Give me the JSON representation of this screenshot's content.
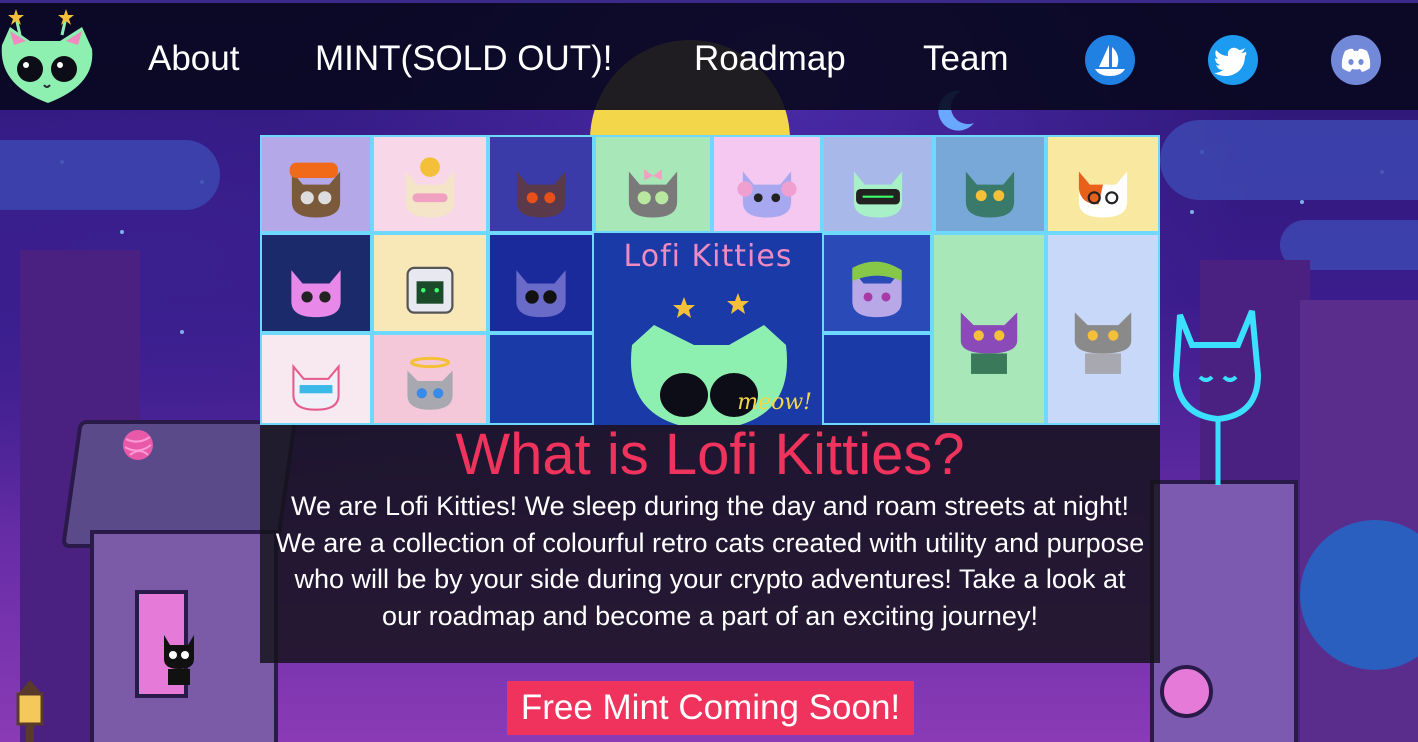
{
  "nav": {
    "about": "About",
    "mint": "MINT(SOLD OUT)!",
    "roadmap": "Roadmap",
    "team": "Team"
  },
  "social": {
    "opensea": "opensea-icon",
    "twitter": "twitter-icon",
    "discord": "discord-icon"
  },
  "banner": {
    "title": "Lofi Kitties",
    "meow": "meow!"
  },
  "about": {
    "title": "What is Lofi Kitties?",
    "text": "We are Lofi Kitties! We sleep during the day and roam streets at night! We are a collection of colourful retro cats created with utility and purpose who will be by your side during your crypto adventures! Take a look at our roadmap and become a part of an exciting journey!"
  },
  "cta": {
    "label": "Free Mint Coming Soon!"
  },
  "colors": {
    "accent": "#f0335c",
    "header_bg": "#08081e",
    "opensea": "#2081e2",
    "twitter": "#1d9bf0",
    "discord": "#7289da"
  }
}
